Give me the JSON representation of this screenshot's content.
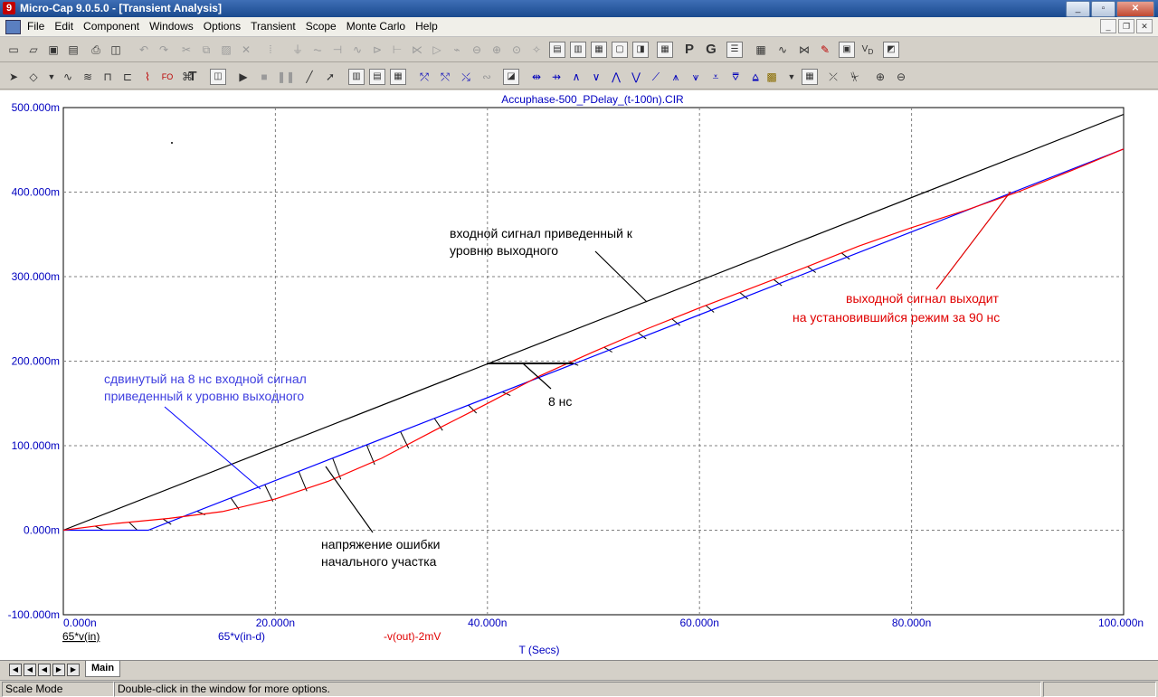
{
  "window": {
    "title": "Micro-Cap 9.0.5.0 - [Transient Analysis]",
    "app_icon": "9"
  },
  "menu": [
    "File",
    "Edit",
    "Component",
    "Windows",
    "Options",
    "Transient",
    "Scope",
    "Monte Carlo",
    "Help"
  ],
  "plot": {
    "title": "Accuphase-500_PDelay_(t-100n).CIR",
    "y_ticks": [
      "500.000m",
      "400.000m",
      "300.000m",
      "200.000m",
      "100.000m",
      "0.000m",
      "-100.000m"
    ],
    "x_ticks": [
      "0.000n",
      "20.000n",
      "40.000n",
      "60.000n",
      "80.000n",
      "100.000n"
    ],
    "x_label": "T (Secs)",
    "trace_labels": [
      "65*v(in)",
      "65*v(in-d)",
      "-v(out)-2mV"
    ],
    "annotations": {
      "input_1": "входной сигнал приведенный к",
      "input_2": "уровню выходного",
      "output_1": "выходной сигнал  выходит",
      "output_2": "на установившийся режим за 90 нс",
      "shifted_1": "сдвинутый на  8  нс входной сигнал",
      "shifted_2": "приведенный к уровню выходного",
      "delay": "8 нс",
      "error_1": "напряжение ошибки",
      "error_2": "начального участка"
    },
    "colors": {
      "input": "#000000",
      "shifted": "#0000ff",
      "output": "#ff0000",
      "axis_text": "#0000c0",
      "grid": "#808080"
    }
  },
  "chart_data": {
    "type": "line",
    "title": "Accuphase-500_PDelay_(t-100n).CIR",
    "xlabel": "T (Secs)",
    "ylabel": "",
    "xlim": [
      0,
      100
    ],
    "ylim": [
      -100,
      500
    ],
    "x_unit": "ns",
    "y_unit": "mV",
    "grid": true,
    "series": [
      {
        "name": "65*v(in)",
        "color": "#000000",
        "x": [
          0,
          100
        ],
        "y": [
          0,
          492
        ]
      },
      {
        "name": "65*v(in-d)",
        "color": "#0000ff",
        "x": [
          0,
          8,
          48,
          100
        ],
        "y": [
          0,
          0,
          196,
          451
        ]
      },
      {
        "name": "-v(out)-2mV",
        "color": "#ff0000",
        "x": [
          0,
          5,
          10,
          15,
          20,
          25,
          30,
          35,
          40,
          45,
          50,
          55,
          60,
          65,
          70,
          75,
          80,
          85,
          90,
          95,
          100
        ],
        "y": [
          0,
          8,
          14,
          22,
          37,
          58,
          85,
          118,
          150,
          183,
          211,
          238,
          263,
          287,
          311,
          336,
          358,
          378,
          400,
          425,
          451
        ]
      }
    ]
  },
  "tabs": {
    "main": "Main"
  },
  "status": {
    "mode": "Scale Mode",
    "hint": "Double-click in the window for more options."
  }
}
